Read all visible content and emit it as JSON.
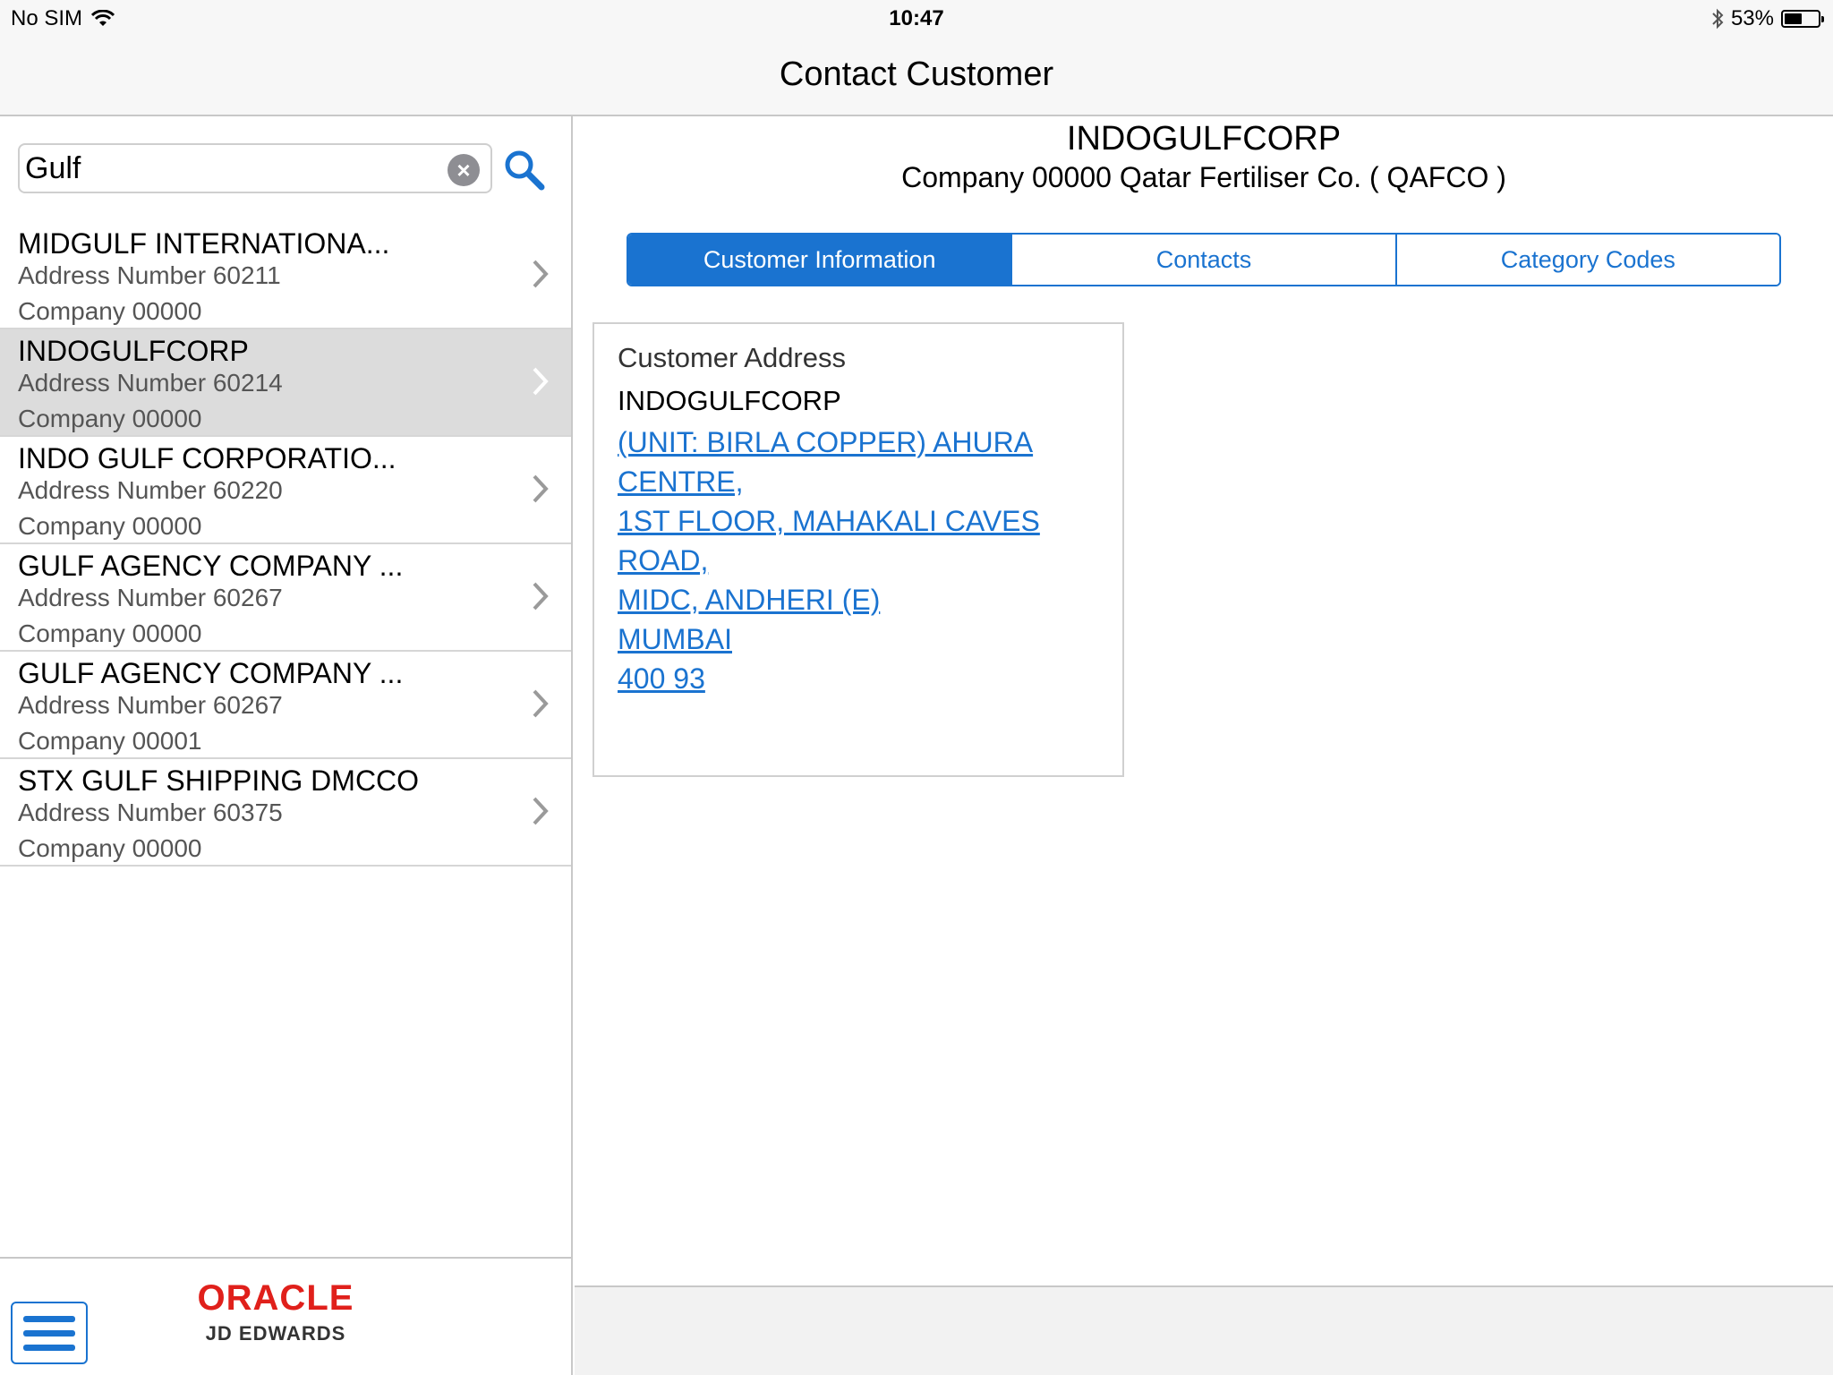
{
  "status_bar": {
    "carrier": "No SIM",
    "time": "10:47",
    "battery_percent": "53%",
    "battery_level": 0.53,
    "icons": [
      "wifi-icon",
      "bluetooth-icon",
      "battery-icon"
    ]
  },
  "nav": {
    "title": "Contact Customer"
  },
  "search": {
    "value": "Gulf",
    "clear_symbol": "×"
  },
  "results": [
    {
      "name": "MIDGULF INTERNATIONA...",
      "address": "Address Number 60211",
      "company": "Company 00000",
      "selected": false
    },
    {
      "name": "INDOGULFCORP",
      "address": "Address Number 60214",
      "company": "Company 00000",
      "selected": true
    },
    {
      "name": "INDO GULF CORPORATIO...",
      "address": "Address Number 60220",
      "company": "Company 00000",
      "selected": false
    },
    {
      "name": "GULF AGENCY COMPANY ...",
      "address": "Address Number 60267",
      "company": "Company 00000",
      "selected": false
    },
    {
      "name": "GULF AGENCY COMPANY ...",
      "address": "Address Number 60267",
      "company": "Company 00001",
      "selected": false
    },
    {
      "name": "STX GULF SHIPPING DMCCO",
      "address": "Address Number 60375",
      "company": "Company 00000",
      "selected": false
    }
  ],
  "branding": {
    "logo_text": "ORACLE",
    "product_text": "JD EDWARDS",
    "logo_color": "#e0201b"
  },
  "detail": {
    "customer_name": "INDOGULFCORP",
    "company_line": "Company 00000  Qatar Fertiliser Co. ( QAFCO )",
    "tabs": [
      {
        "label": "Customer Information",
        "active": true
      },
      {
        "label": "Contacts",
        "active": false
      },
      {
        "label": "Category Codes",
        "active": false
      }
    ],
    "address_card": {
      "heading": "Customer Address",
      "name": "INDOGULFCORP",
      "lines": [
        "(UNIT: BIRLA COPPER) AHURA",
        "CENTRE,",
        "1ST FLOOR, MAHAKALI CAVES",
        "ROAD,",
        "MIDC, ANDHERI (E)",
        "MUMBAI",
        "400 93"
      ]
    }
  },
  "colors": {
    "accent": "#1a73d0",
    "selected_row": "#dcdcdc",
    "bar_background": "#f7f7f7"
  }
}
